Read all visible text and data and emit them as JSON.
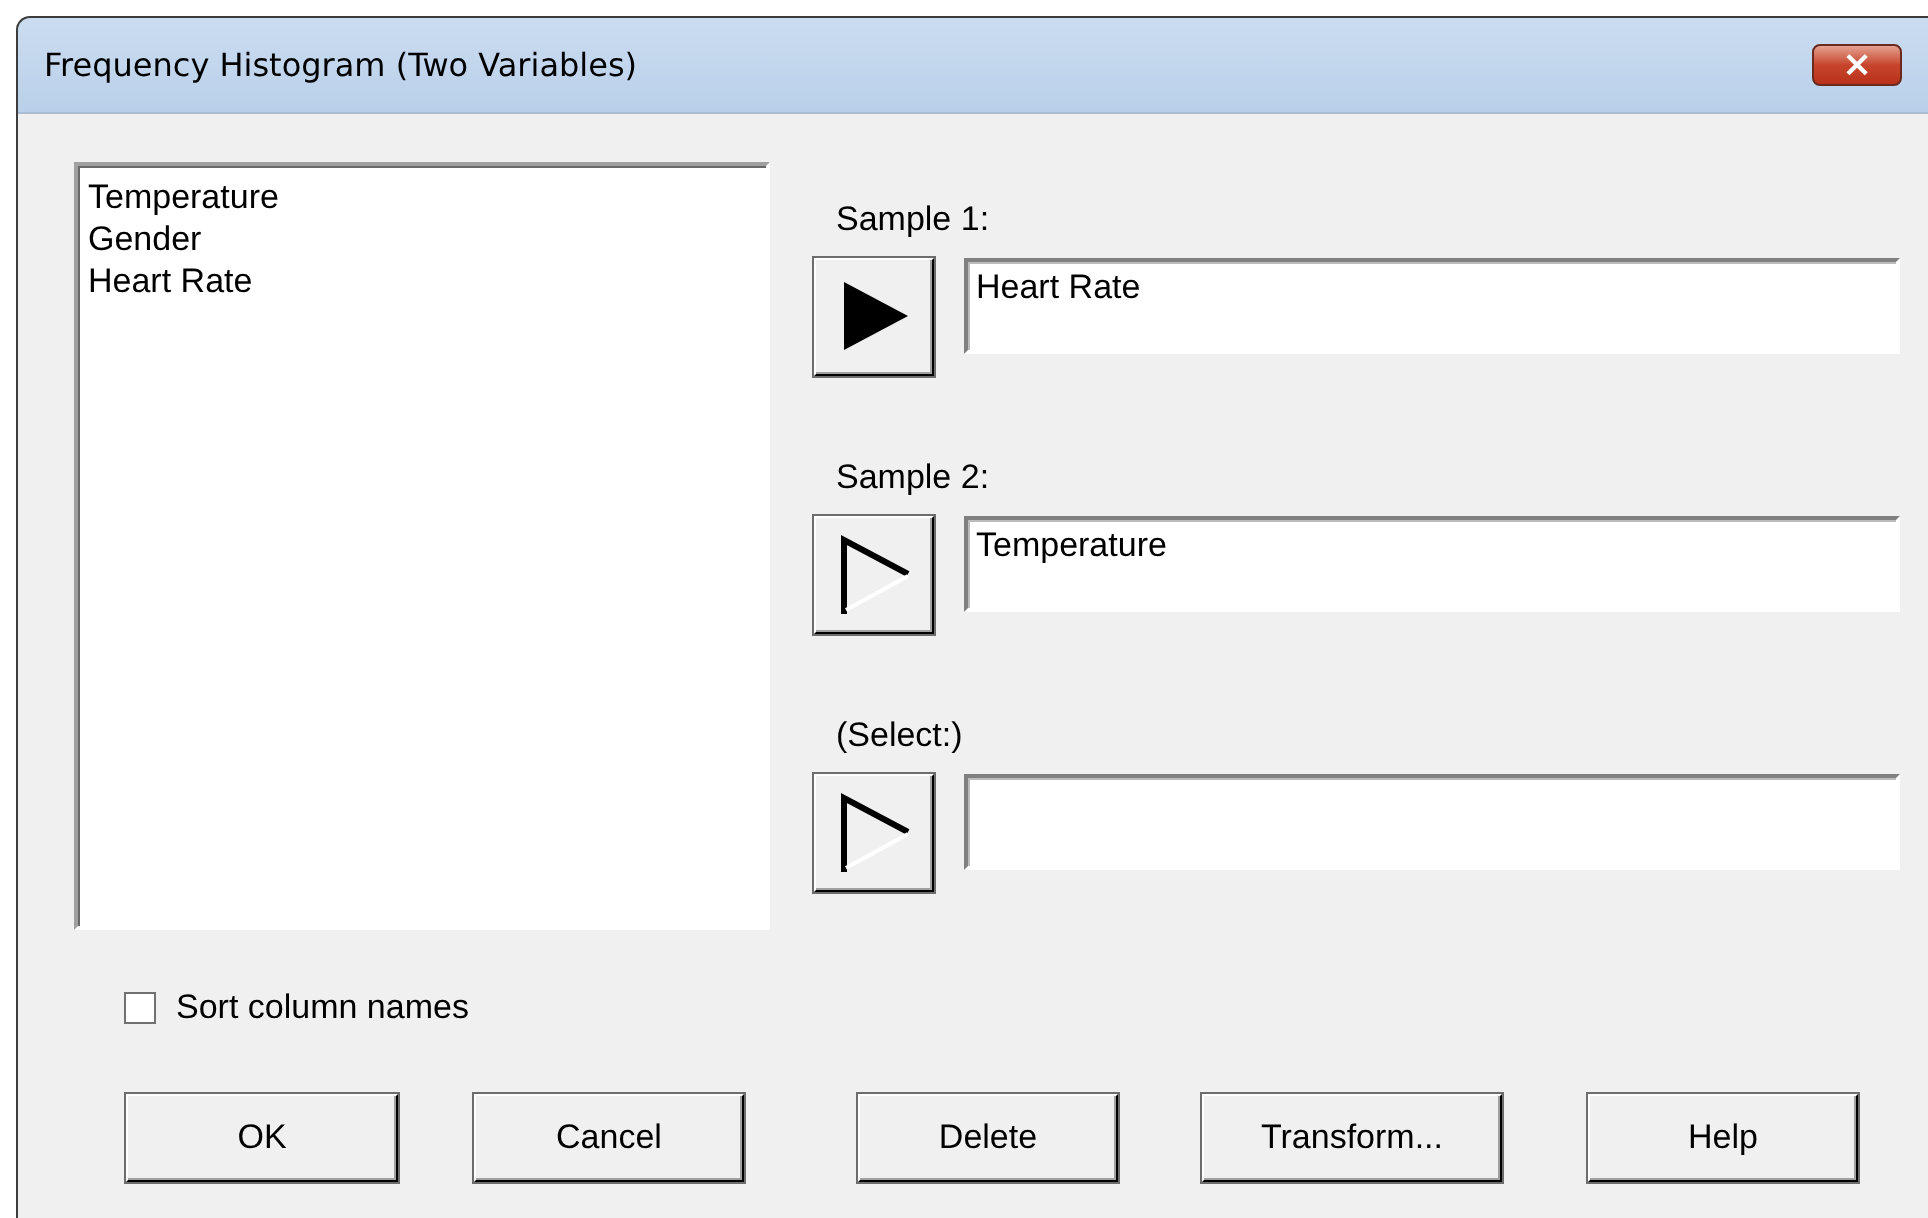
{
  "window": {
    "title": "Frequency Histogram (Two Variables)",
    "close_label": "×"
  },
  "variables": [
    "Temperature",
    "Gender",
    "Heart Rate"
  ],
  "slots": [
    {
      "label": "Sample 1:",
      "value": "Heart Rate",
      "selected": true
    },
    {
      "label": "Sample 2:",
      "value": "Temperature",
      "selected": false
    },
    {
      "label": "(Select:)",
      "selected": false
    }
  ],
  "sort_checkbox": {
    "label": "Sort column names",
    "checked": false
  },
  "buttons": [
    "OK",
    "Cancel",
    "Delete",
    "Transform...",
    "Help"
  ]
}
